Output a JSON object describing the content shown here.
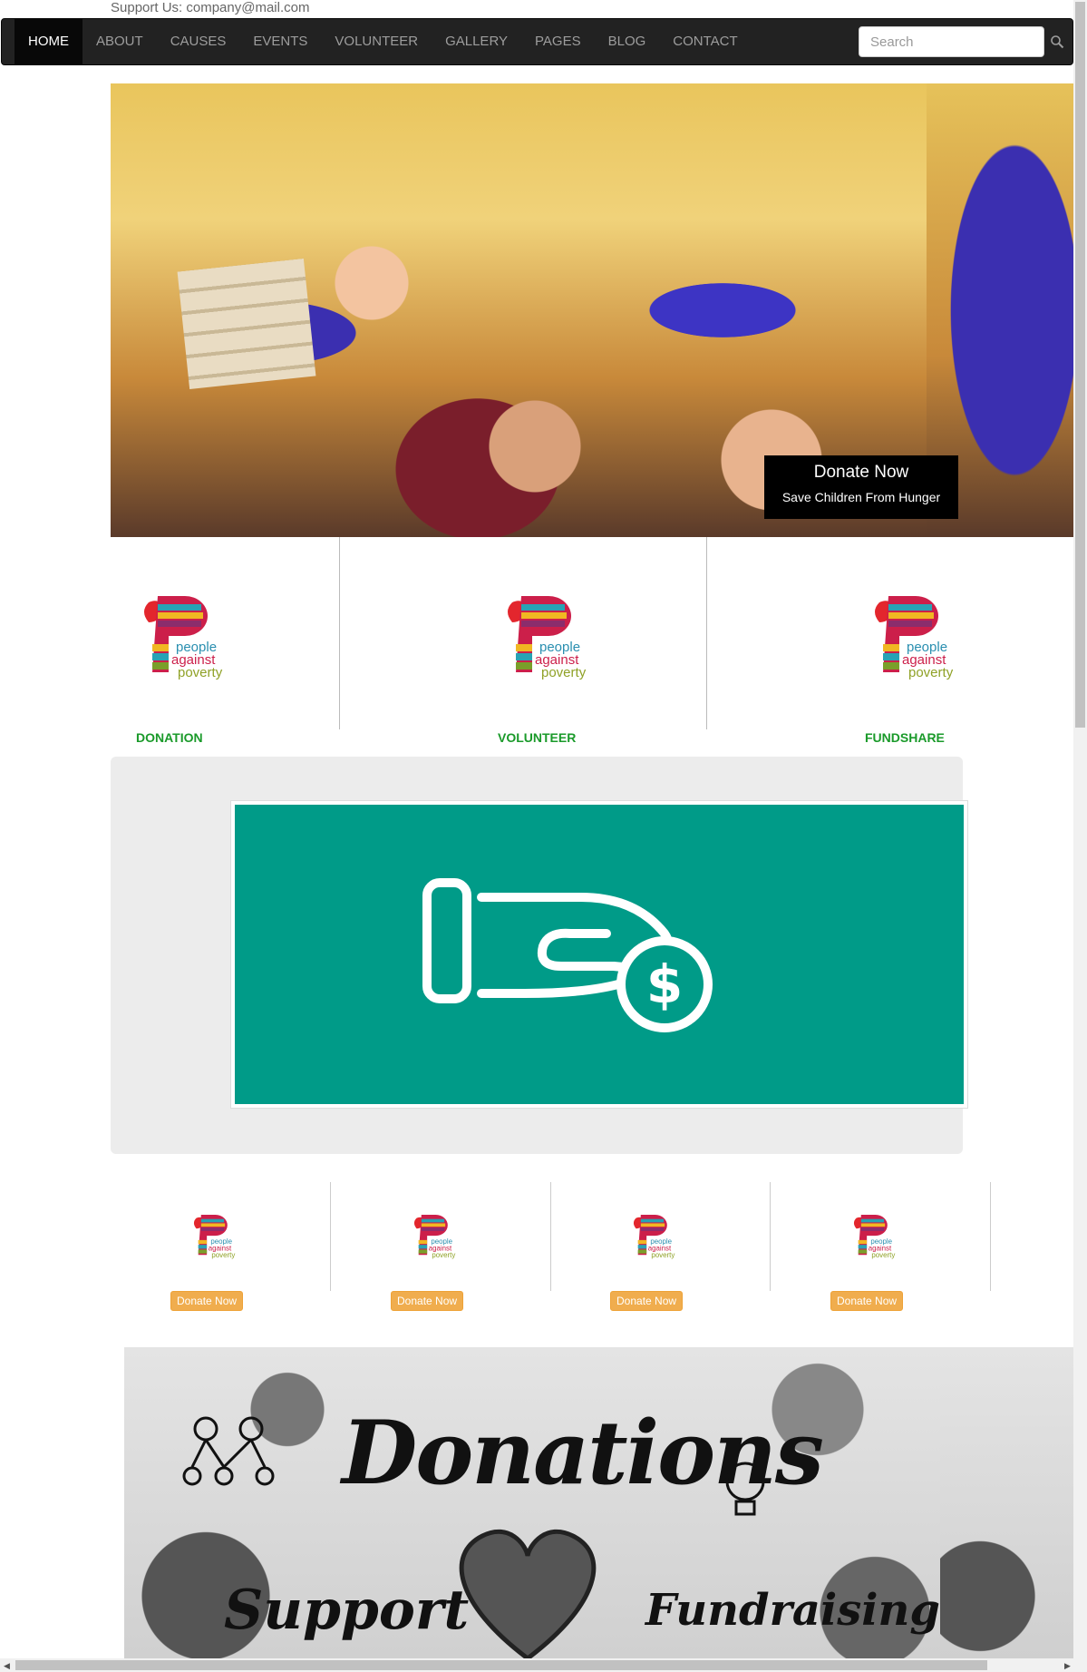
{
  "support": {
    "text": "Support Us: company@mail.com"
  },
  "nav": {
    "items": [
      {
        "label": "HOME",
        "active": true
      },
      {
        "label": "ABOUT",
        "active": false
      },
      {
        "label": "CAUSES",
        "active": false
      },
      {
        "label": "EVENTS",
        "active": false
      },
      {
        "label": "VOLUNTEER",
        "active": false
      },
      {
        "label": "GALLERY",
        "active": false
      },
      {
        "label": "PAGES",
        "active": false
      },
      {
        "label": "BLOG",
        "active": false
      },
      {
        "label": "CONTACT",
        "active": false
      }
    ],
    "search_placeholder": "Search",
    "search_icon": "search-icon"
  },
  "hero": {
    "caption_title": "Donate Now",
    "caption_subtitle": "Save Children From Hunger"
  },
  "logo": {
    "line1": "people",
    "line2": "against",
    "line3": "poverty"
  },
  "features": [
    {
      "label": "DONATION"
    },
    {
      "label": "VOLUNTEER"
    },
    {
      "label": "FUNDSHARE"
    }
  ],
  "donate_panel": {
    "icon": "hand-coin-dollar-icon",
    "color": "#009b88"
  },
  "cards": [
    {
      "button": "Donate Now"
    },
    {
      "button": "Donate Now"
    },
    {
      "button": "Donate Now"
    },
    {
      "button": "Donate Now"
    }
  ],
  "banner": {
    "title": "Donations",
    "left_word": "Support",
    "right_word": "Fundraising"
  },
  "colors": {
    "navbar": "#222222",
    "feature_label": "#1a9a2a",
    "donate_button": "#f0ad4e",
    "caption_bg": "#000000"
  }
}
